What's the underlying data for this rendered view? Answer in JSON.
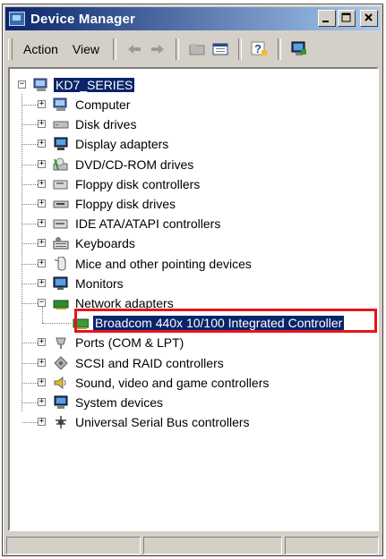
{
  "window": {
    "title": "Device Manager"
  },
  "menu": {
    "action": "Action",
    "view": "View"
  },
  "toolbar_icons": [
    "back-arrow-icon",
    "forward-arrow-icon",
    "folder-icon",
    "properties-icon",
    "help-icon",
    "monitor-scan-icon"
  ],
  "tree": {
    "root": "KD7_SERIES",
    "items": [
      {
        "label": "Computer",
        "icon": "computer-icon"
      },
      {
        "label": "Disk drives",
        "icon": "disk-drive-icon"
      },
      {
        "label": "Display adapters",
        "icon": "display-adapter-icon"
      },
      {
        "label": "DVD/CD-ROM drives",
        "icon": "cdrom-icon"
      },
      {
        "label": "Floppy disk controllers",
        "icon": "floppy-controller-icon"
      },
      {
        "label": "Floppy disk drives",
        "icon": "floppy-drive-icon"
      },
      {
        "label": "IDE ATA/ATAPI controllers",
        "icon": "ide-controller-icon"
      },
      {
        "label": "Keyboards",
        "icon": "keyboard-icon"
      },
      {
        "label": "Mice and other pointing devices",
        "icon": "mouse-icon"
      },
      {
        "label": "Monitors",
        "icon": "monitor-icon"
      },
      {
        "label": "Network adapters",
        "icon": "network-adapter-icon"
      },
      {
        "label": "Broadcom 440x 10/100 Integrated Controller",
        "icon": "network-card-icon"
      },
      {
        "label": "Ports (COM & LPT)",
        "icon": "port-icon"
      },
      {
        "label": "SCSI and RAID controllers",
        "icon": "scsi-icon"
      },
      {
        "label": "Sound, video and game controllers",
        "icon": "sound-icon"
      },
      {
        "label": "System devices",
        "icon": "system-devices-icon"
      },
      {
        "label": "Universal Serial Bus controllers",
        "icon": "usb-icon"
      }
    ]
  },
  "colors": {
    "selection": "#0a246a",
    "highlight_border": "#e8141c",
    "titlebar_start": "#0a246a",
    "titlebar_end": "#a6caf0"
  }
}
